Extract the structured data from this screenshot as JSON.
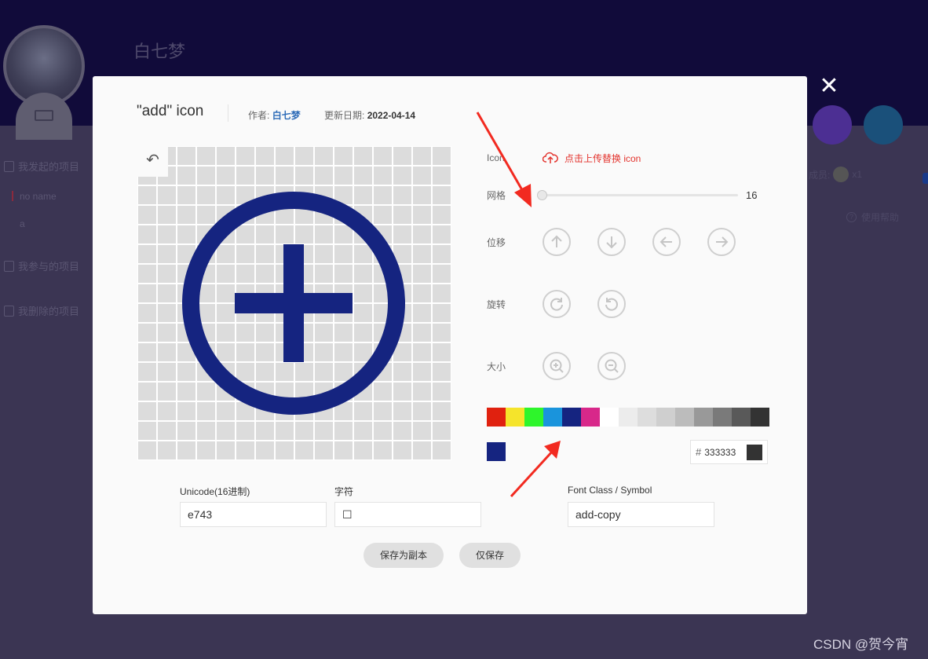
{
  "background": {
    "site_name": "白七梦",
    "sidebar": [
      {
        "label": "我发起的项目"
      },
      {
        "label": "我参与的项目"
      },
      {
        "label": "我删除的项目"
      }
    ],
    "sub_items": [
      "no name",
      "a"
    ],
    "members_label": "成员:",
    "members_count": "x1",
    "help_label": "使用帮助",
    "btn_colors": {
      "purple": "#4c2f93",
      "blue": "#1a507a"
    }
  },
  "modal": {
    "title": "\"add\"  icon",
    "author_label": "作者:",
    "author": "白七梦",
    "date_label": "更新日期:",
    "date": "2022-04-14",
    "icon_color": "#152480",
    "rows": {
      "icon": "Icon",
      "grid": "网格",
      "move": "位移",
      "rotate": "旋转",
      "size": "大小"
    },
    "upload_label": "点击上传替换 icon",
    "grid_value": "16",
    "palette": [
      "#e0210f",
      "#f5e42b",
      "#2ef52b",
      "#1a94dc",
      "#152480",
      "#d8288a",
      "#ffffff",
      "#ececec",
      "#dddddd",
      "#cfcfcf",
      "#bcbcbc",
      "#999999",
      "#7a7a7a",
      "#595959",
      "#333333"
    ],
    "current_color": "#152480",
    "hex_prefix": "#",
    "hex_value": "333333",
    "fields": {
      "unicode_label": "Unicode(16进制)",
      "unicode_value": "e743",
      "char_label": "字符",
      "char_value": "☐",
      "class_label": "Font Class / Symbol",
      "class_value": "add-copy"
    },
    "buttons": {
      "save_copy": "保存为副本",
      "save_only": "仅保存"
    }
  },
  "close_glyph": "✕",
  "watermark": "CSDN @贺今宵"
}
